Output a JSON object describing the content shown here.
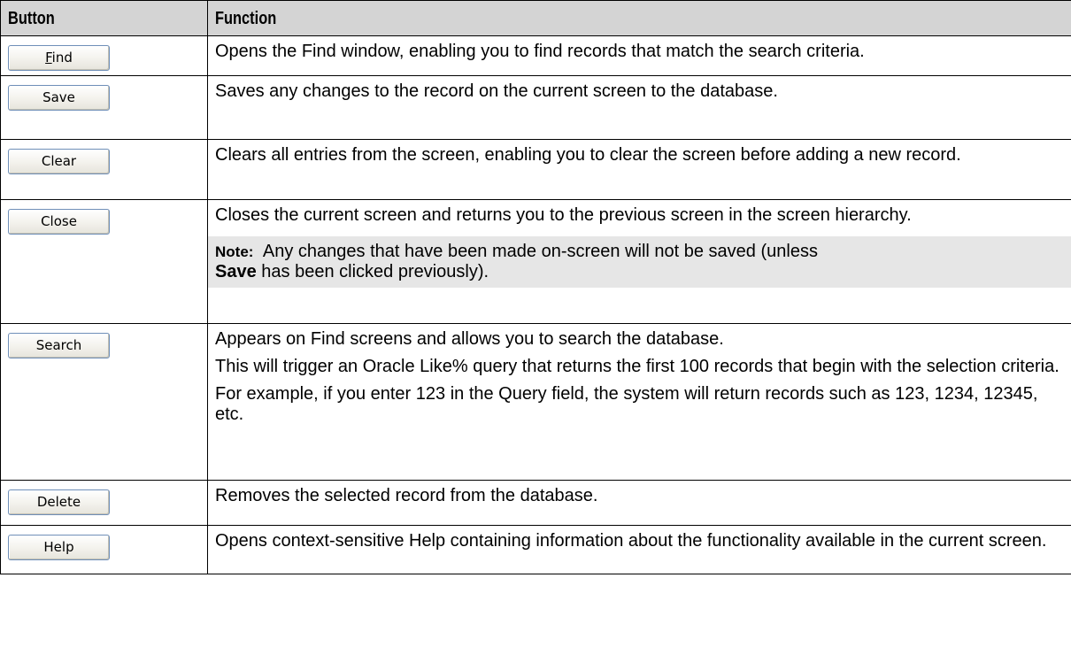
{
  "table": {
    "headers": {
      "button": "Button",
      "function": "Function"
    },
    "rows": [
      {
        "button_label_prefix": "",
        "button_label_underlined": "F",
        "button_label_rest": "ind",
        "description": [
          "Opens the Find window, enabling you to find records that match the search criteria."
        ]
      },
      {
        "button_label": "Save",
        "description": [
          "Saves any changes to the record on the current screen to the database."
        ]
      },
      {
        "button_label": "Clear",
        "description": [
          "Clears all entries from the screen, enabling you to clear the screen before adding a new record."
        ]
      },
      {
        "button_label": "Close",
        "description": [
          "Closes the current screen and returns you to the previous screen in the screen hierarchy."
        ],
        "note": {
          "label": "Note:",
          "text_before": "Any changes that have been made on-screen will not be saved (unless",
          "bold": "Save",
          "text_after": "has been clicked previously)."
        }
      },
      {
        "button_label": "Search",
        "description": [
          "Appears on Find screens and allows you to search the database.",
          "This will trigger an Oracle Like% query that returns the first 100 records that begin with the selection criteria.",
          "For example, if you enter 123 in the Query field, the system will return records such as 123, 1234, 12345, etc."
        ]
      },
      {
        "button_label": "Delete",
        "description": [
          "Removes the selected record from the database."
        ]
      },
      {
        "button_label": "Help",
        "description": [
          "Opens context-sensitive Help containing information about the functionality available in the current screen."
        ]
      }
    ]
  }
}
